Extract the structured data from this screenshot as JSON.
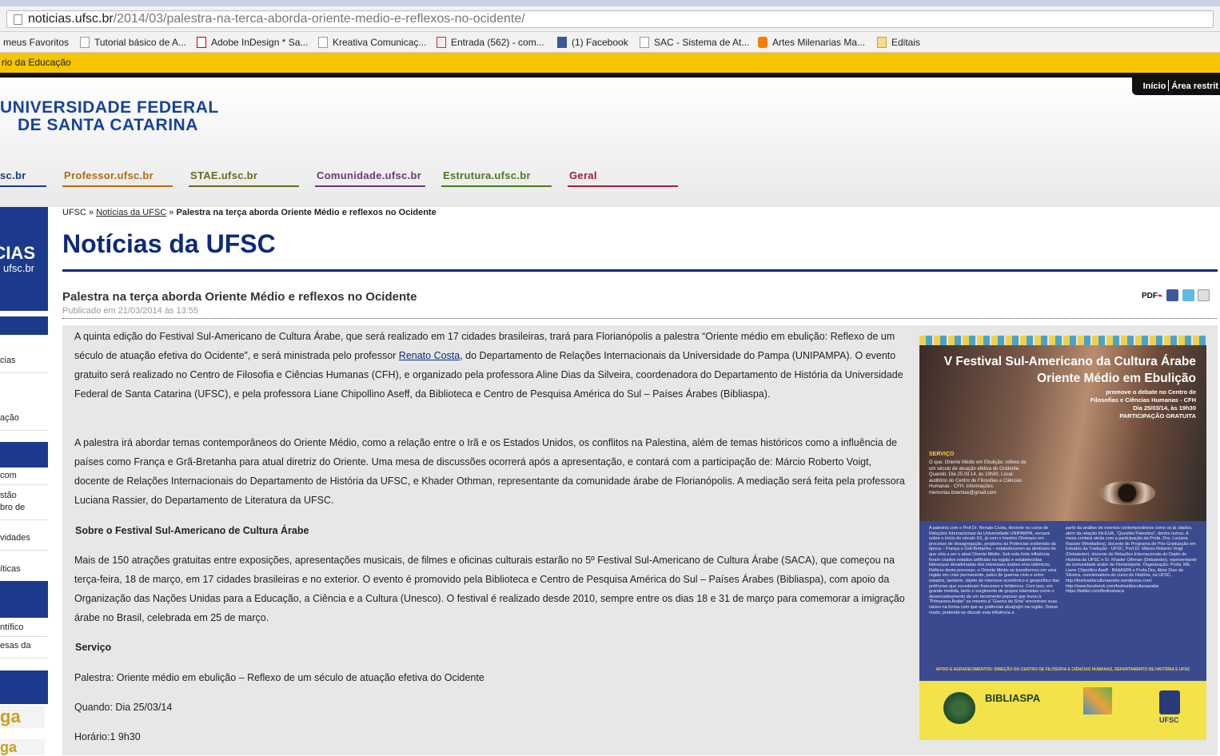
{
  "browser": {
    "url_host": "noticias.ufsc.br",
    "url_path": "/2014/03/palestra-na-terca-aborda-oriente-medio-e-reflexos-no-ocidente/",
    "bookmarks": [
      {
        "label": "meus Favoritos",
        "icon": "folder-icon"
      },
      {
        "label": "Tutorial básico de A...",
        "icon": "page-icon"
      },
      {
        "label": "Adobe InDesign * Sa...",
        "icon": "adobe-icon"
      },
      {
        "label": "Kreativa Comunicaç...",
        "icon": "page-icon"
      },
      {
        "label": "Entrada (562) - com...",
        "icon": "gmail-icon"
      },
      {
        "label": "(1) Facebook",
        "icon": "facebook-icon"
      },
      {
        "label": "SAC - Sistema de At...",
        "icon": "page-icon"
      },
      {
        "label": "Artes Milenarias Ma...",
        "icon": "blogger-icon"
      },
      {
        "label": "Editais",
        "icon": "folder-icon"
      }
    ]
  },
  "govbar": {
    "text": "rio da Educação"
  },
  "topnav": {
    "inicio": "Início",
    "restrita": "Área restrit"
  },
  "header": {
    "line1": "UNIVERSIDADE FEDERAL",
    "line2": "DE SANTA CATARINA",
    "tabs": [
      {
        "label": "sc.br",
        "color": "#1c3a8c"
      },
      {
        "label": "Professor.ufsc.br",
        "color": "#b36a14"
      },
      {
        "label": "STAE.ufsc.br",
        "color": "#6a6a1c"
      },
      {
        "label": "Comunidade.ufsc.br",
        "color": "#6b3a7a"
      },
      {
        "label": "Estrutura.ufsc.br",
        "color": "#4a7a1c"
      },
      {
        "label": "Geral",
        "color": "#a01c3a"
      }
    ]
  },
  "sidebar": {
    "brand_big": "ÍCIAS",
    "brand_small": "ufsc.br",
    "items": [
      "cias",
      "ação",
      "com",
      "stão",
      "bro de",
      "vidades",
      "íticas",
      "ntífico",
      "esas da"
    ]
  },
  "breadcrumb": {
    "root": "UFSC",
    "sep": "»",
    "section": "Notícias da UFSC",
    "current": "Palestra na terça aborda Oriente Médio e reflexos no Ocidente"
  },
  "page_title": "Notícias da UFSC",
  "article": {
    "title": "Palestra na terça aborda Oriente Médio e reflexos no Ocidente",
    "published": "Publicado em 21/03/2014 às 13:55",
    "share_pdf": "PDF",
    "p1_a": "A quinta edição do Festival Sul-Americano de Cultura Árabe, que será realizado em 17 cidades brasileiras, trará para Florianópolis a palestra “Oriente médio em ebulição: Reflexo de um século de atuação efetiva do Ocidente”, e será ministrada pelo professor ",
    "p1_link": "Renato Costa",
    "p1_b": ", do Departamento de Relações Internacionais da Universidade do Pampa (UNIPAMPA). O evento gratuito será realizado no Centro de Filosofia e Ciências Humanas (CFH), e organizado pela professora Aline Dias da Silveira, coordenadora do Departamento de História da Universidade Federal de Santa Catarina (UFSC), e pela professora Liane Chipollino Aseff, da Biblioteca e Centro de Pesquisa América do Sul – Países Árabes (Bibliaspa).",
    "p2": "A palestra irá abordar temas contemporâneos do Oriente Médio, como a relação entre o Irã e os Estados Unidos, os conflitos na Palestina, além de temas históricos como a influência de países como França e Grã-Bretanha para atual diretriz do Oriente. Uma mesa de discussões ocorrerá após a apresentação, e contará com a participação de: Márcio Roberto Voigt, docente de Relações Internacionais do Departamento de História da UFSC, e Khader Othman, representante da comunidade árabe de Florianópolis. A mediação será feita pela professora Luciana Rassier, do Departamento de Literatura da UFSC.",
    "h_sobre": "Sobre o Festival Sul-Americano de Cultura Árabe",
    "p3": "Mais de 150 atrações gratuitas entre exposições, apresentações musicais, de filmes e oficinas culturais estarão no 5º Festival Sul-Americano de Cultura Árabe (SACA), que começou na terça-feira, 18 de março, em 17 cidades brasileiras e no exterior. O evento é promovido pela Biblioteca e Centro de Pesquisa América do Sul – Países Árabes (Bibliaspa), com apoio da Organização das Nações Unidas para a Educação, a Ciência e a Cultura (Unesco). O festival é realizado desde 2010, sempre entre os dias 18 e 31 de março para comemorar a imigração árabe no Brasil, celebrada em 25 de março.",
    "h_servico": "Serviço",
    "s1": "Palestra: Oriente médio em ebulição – Reflexo de um século de atuação efetiva do Ocidente",
    "s2": "Quando: Dia 25/03/14",
    "s3": "Horário:1 9h30"
  },
  "poster": {
    "title1": "V Festival Sul-Americano da Cultura Árabe",
    "title2": "Oriente Médio em Ebulição",
    "sub1": "promove o debate no Centro de",
    "sub2": "Filosofias e Ciências Humanas - CFH",
    "sub3": "Dia 25/03/14, às 19h30",
    "sub4": "PARTICIPAÇÃO GRATUITA",
    "servico": "SERVIÇO",
    "info": "O que: Oriente Médio em Ebulição: reflexo de um século de atuação efetiva do Ocidente. Quando: Dia 25.03.14, às 19h30. Local: auditório do Centro de Filosofias e Ciências Humanas - CFH. Informações: memorias.boemias@gmail.com",
    "body_left": "A palestra com o Prof.Dr. Renato Costa, docente no curso de Relações Internacionais da Universidade UNIPAMPA, versará sobre o início do século XX, já com o Império Otomano em processo de desagregação, propiciou às Potências ocidentais da época – França e Grã-Bretanha – estabelecerem as diretrizes do que viria a ser o atual Oriente Médio. Sob esta forte influência foram criados estados artificiais na região e estabelecidas lideranças desalinhadas dos interesses árabes e/ou islâmicos. Reflexo deste processo, o Oriente Médio se transformou em uma região em crise permanente, palco de guerras civis e entre estados, também, objeto de interesse econômico e geopolítico das potências que sucederam franceses e britânicos. Com isso, em grande medida, tanto o surgimento de grupos islamistas como o desencadeamento de um movimento popular que levou à “Primavera Árabe” ou mesmo à “Guerra da Síria” encontram suas raízes na forma com que as potências atua[ra]m na região. Desse modo, pretende-se discutir esta influência a",
    "body_right": "partir da análise de eventos contemporâneos como os já citados, além da relação Irã-EUA, “Questão Palestina”, dentre outros. A mesa contará ainda com a participação da Profa. Dra. Luciana Rassier (Mediadora), docente do Programa de Pós-Graduação em Estudos da Tradução - UFSC, Prof.Dr. Márcio Roberto Voigt (Debatedor), docente de Relações Internacionais do Depto de História da UFSC e Sr. Khader Othman (Debatedor), representante da comunidade árabe de Florianópolis. Organização: Profa. ME. Liane Chipollino Aseff - BibliASPA e Profa.Dra. Aline Dias da Silveira, coordenadora do curso de História, na UFSC. http://festivaldaculturaarabe.wordpress.com/ http://www.facebook.com/festivaldaculturaarabe https://twitter.com/festivalsaca",
    "apoio": "APOIO E AGRADECIMENTOS: DIREÇÃO DO CENTRO DE FILOSOFIA E CIÊNCIAS HUMANAS, DEPARTAMENTO DE HISTÓRIA E UFSC",
    "bibliaspa": "BIBLIASPA",
    "ufsc": "UFSC"
  }
}
